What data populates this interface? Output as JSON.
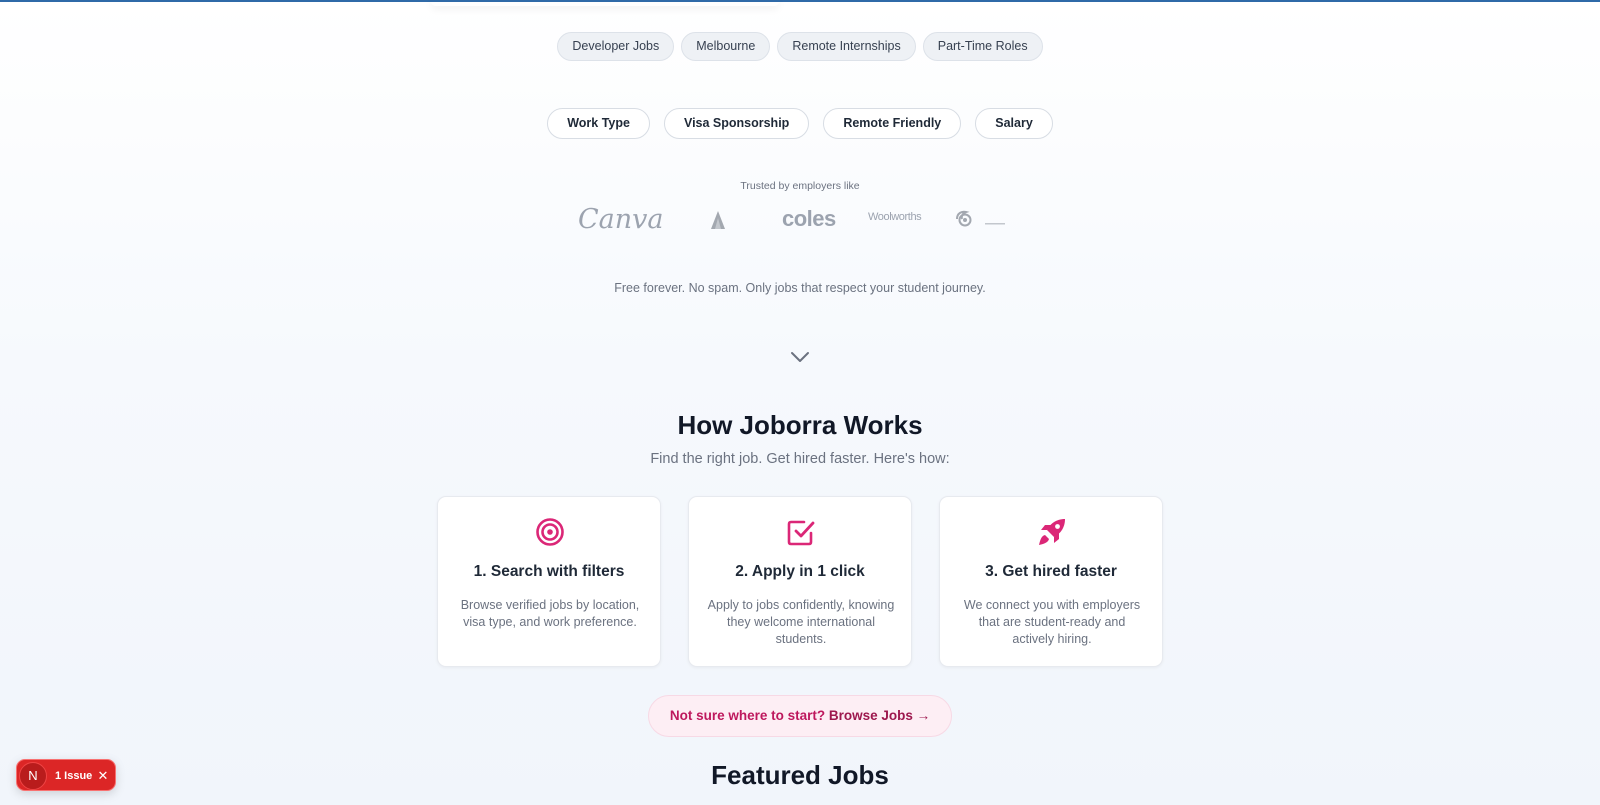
{
  "quick_searches": [
    "Developer Jobs",
    "Melbourne",
    "Remote Internships",
    "Part-Time Roles"
  ],
  "filters": [
    "Work Type",
    "Visa Sponsorship",
    "Remote Friendly",
    "Salary"
  ],
  "trusted": {
    "label": "Trusted by employers like",
    "logos": {
      "canva": "Canva",
      "coles": "coles",
      "woolworths": "Woolworths"
    }
  },
  "free_text": "Free forever. No spam. Only jobs that respect your student journey.",
  "how_it_works": {
    "title": "How Joborra Works",
    "subtitle": "Find the right job. Get hired faster. Here's how:",
    "steps": [
      {
        "icon": "target-icon",
        "title": "1. Search with filters",
        "description": "Browse verified jobs by location, visa type, and work preference."
      },
      {
        "icon": "check-square-icon",
        "title": "2. Apply in 1 click",
        "description": "Apply to jobs confidently, knowing they welcome international students."
      },
      {
        "icon": "rocket-icon",
        "title": "3. Get hired faster",
        "description": "We connect you with employers that are student-ready and actively hiring."
      }
    ]
  },
  "cta": {
    "prefix": "Not sure where to start?",
    "link": "Browse Jobs →"
  },
  "featured": {
    "title": "Featured Jobs"
  },
  "dev_indicator": {
    "logo": "N",
    "label": "1 Issue",
    "close": "✕"
  },
  "colors": {
    "accent": "#db2777",
    "accent_dark": "#be185d",
    "issue_red": "#dc2626",
    "top_line": "#2f6aa8"
  }
}
